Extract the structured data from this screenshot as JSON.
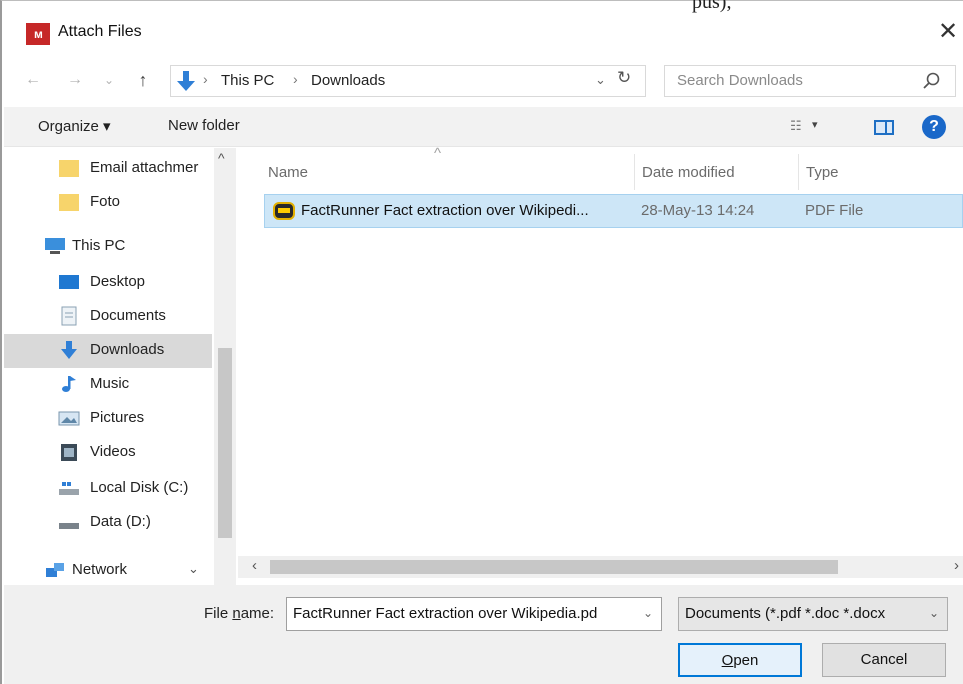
{
  "window": {
    "top_fragment": "pus),",
    "title": "Attach Files",
    "close_glyph": "✕"
  },
  "address_bar": {
    "back_glyph": "←",
    "forward_glyph": "→",
    "recent_glyph": "⌄",
    "up_glyph": "↑",
    "crumbs": [
      "This PC",
      "Downloads"
    ],
    "separator": "›",
    "dropdown_glyph": "⌄",
    "refresh_glyph": "↻"
  },
  "search": {
    "placeholder": "Search Downloads"
  },
  "toolbar": {
    "organize_label": "Organize ▾",
    "new_folder_label": "New folder",
    "view_glyph": "☷",
    "view_arrow": "▾",
    "help_glyph": "?"
  },
  "nav": {
    "items": [
      {
        "label": "Email attachmer",
        "icon": "folder-icon"
      },
      {
        "label": "Foto",
        "icon": "folder-icon"
      },
      {
        "label": "This PC",
        "icon": "computer-icon"
      },
      {
        "label": "Desktop",
        "icon": "desktop-icon"
      },
      {
        "label": "Documents",
        "icon": "documents-icon"
      },
      {
        "label": "Downloads",
        "icon": "downloads-icon",
        "selected": true
      },
      {
        "label": "Music",
        "icon": "music-icon"
      },
      {
        "label": "Pictures",
        "icon": "pictures-icon"
      },
      {
        "label": "Videos",
        "icon": "videos-icon"
      },
      {
        "label": "Local Disk (C:)",
        "icon": "local-disk-icon"
      },
      {
        "label": "Data (D:)",
        "icon": "drive-icon"
      },
      {
        "label": "Network",
        "icon": "network-icon"
      }
    ],
    "collapse_glyph": "⌄",
    "scroll_up_glyph": "^"
  },
  "file_list": {
    "columns": [
      "Name",
      "Date modified",
      "Type"
    ],
    "sort_glyph": "^",
    "rows": [
      {
        "name": "FactRunner Fact extraction over Wikipedi...",
        "date_modified": "28-May-13 14:24",
        "type": "PDF File",
        "selected": true
      }
    ],
    "scroll_left_glyph": "‹",
    "scroll_right_glyph": "›"
  },
  "bottom": {
    "file_name_label": "File name:",
    "file_name_label_pre": "File ",
    "file_name_label_accel": "n",
    "file_name_label_post": "ame:",
    "file_name_value": "FactRunner Fact extraction over Wikipedia.pd",
    "file_type_value": "Documents (*.pdf *.doc *.docx",
    "dropdown_glyph": "⌄",
    "open_label": "Open",
    "open_accel": "O",
    "open_rest": "pen",
    "cancel_label": "Cancel"
  },
  "colors": {
    "accent": "#0078d7",
    "selection": "#cde6f7",
    "nav_selected": "#d9d9d9",
    "app_icon": "#c62828"
  }
}
